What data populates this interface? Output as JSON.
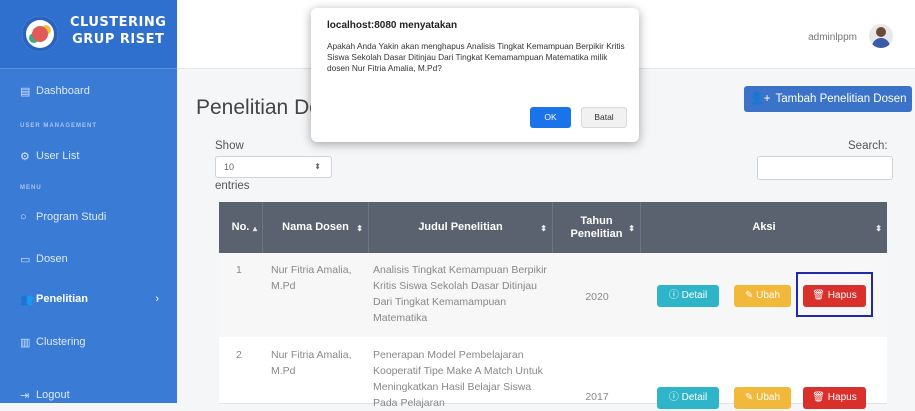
{
  "brand": {
    "line1": "CLUSTERING",
    "line2": "GRUP RISET"
  },
  "sidebar": {
    "dashboard": "Dashboard",
    "user_management_header": "USER MANAGEMENT",
    "user_list": "User List",
    "menu_header": "MENU",
    "program_studi": "Program Studi",
    "dosen": "Dosen",
    "penelitian": "Penelitian",
    "clustering": "Clustering",
    "logout": "Logout"
  },
  "topbar": {
    "user_name": "adminlppm"
  },
  "page": {
    "title": "Penelitian Dosen",
    "add_button": "Tambah Penelitian Dosen"
  },
  "datatable": {
    "show_label": "Show",
    "page_size": "10",
    "entries_label": "entries",
    "search_label": "Search:"
  },
  "table": {
    "headers": {
      "no": "No.",
      "nama": "Nama Dosen",
      "judul": "Judul Penelitian",
      "tahun": "Tahun Penelitian",
      "aksi": "Aksi"
    },
    "rows": [
      {
        "no": "1",
        "nama": "Nur Fitria Amalia, M.Pd",
        "judul": "Analisis Tingkat Kemampuan Berpikir Kritis Siswa Sekolah Dasar Ditinjau Dari Tingkat Kemamampuan Matematika",
        "tahun": "2020"
      },
      {
        "no": "2",
        "nama": "Nur Fitria Amalia, M.Pd",
        "judul": "Penerapan Model Pembelajaran Kooperatif Tipe Make A Match Untuk Meningkatkan Hasil Belajar Siswa Pada Pelajaran",
        "tahun": "2017"
      }
    ],
    "actions": {
      "detail": "Detail",
      "ubah": "Ubah",
      "hapus": "Hapus"
    }
  },
  "dialog": {
    "title": "localhost:8080 menyatakan",
    "message": "Apakah Anda Yakin akan menghapus Analisis Tingkat Kemampuan Berpikir Kritis Siswa Sekolah Dasar Ditinjau Dari Tingkat Kemamampuan Matematika milik dosen Nur Fitria Amalia, M.Pd?",
    "ok": "OK",
    "cancel": "Batal"
  },
  "colors": {
    "sidebar": "#3a7bd5",
    "primary_button": "#3b73c9",
    "table_header": "#5a6270",
    "detail": "#2fb5c9",
    "ubah": "#f2b83a",
    "hapus": "#d9302c",
    "highlight_box": "#1f2aa8",
    "dialog_ok": "#1a73e8"
  },
  "icons": {
    "dashboard": "dashboard-icon",
    "user_list": "gear-icon",
    "program_studi": "circle-icon",
    "dosen": "folder-icon",
    "penelitian": "users-icon",
    "clustering": "bar-chart-icon",
    "logout": "logout-icon",
    "add": "user-plus-icon",
    "detail": "info-icon",
    "ubah": "edit-icon",
    "hapus": "trash-icon"
  }
}
